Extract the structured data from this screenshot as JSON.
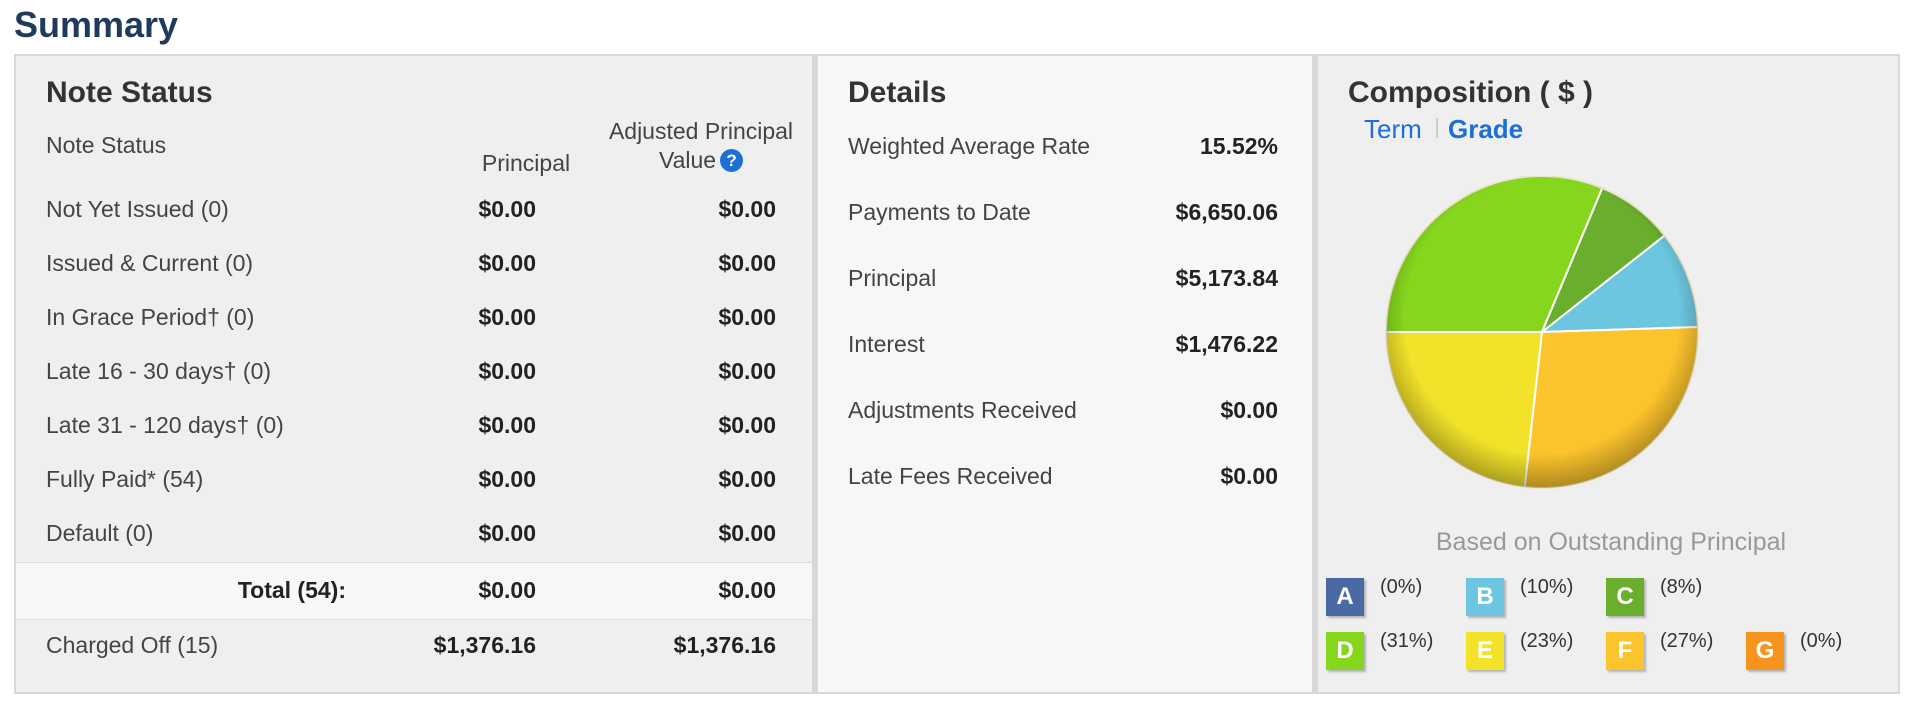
{
  "page": {
    "title": "Summary"
  },
  "note_status": {
    "title": "Note Status",
    "columns": {
      "status": "Note Status",
      "principal": "Principal",
      "adjusted_line1": "Adjusted Principal",
      "adjusted_line2": "Value"
    },
    "help_icon_glyph": "?",
    "rows": [
      {
        "label": "Not Yet Issued (0)",
        "principal": "$0.00",
        "adjusted": "$0.00"
      },
      {
        "label": "Issued & Current (0)",
        "principal": "$0.00",
        "adjusted": "$0.00"
      },
      {
        "label": "In Grace Period† (0)",
        "principal": "$0.00",
        "adjusted": "$0.00"
      },
      {
        "label": "Late 16 - 30 days† (0)",
        "principal": "$0.00",
        "adjusted": "$0.00"
      },
      {
        "label": "Late 31 - 120 days† (0)",
        "principal": "$0.00",
        "adjusted": "$0.00"
      },
      {
        "label": "Fully Paid* (54)",
        "principal": "$0.00",
        "adjusted": "$0.00"
      },
      {
        "label": "Default (0)",
        "principal": "$0.00",
        "adjusted": "$0.00"
      }
    ],
    "total": {
      "label": "Total (54):",
      "principal": "$0.00",
      "adjusted": "$0.00"
    },
    "charged_off": {
      "label": "Charged Off (15)",
      "principal": "$1,376.16",
      "adjusted": "$1,376.16"
    }
  },
  "details": {
    "title": "Details",
    "rows": [
      {
        "label": "Weighted Average Rate",
        "value": "15.52%"
      },
      {
        "label": "Payments to Date",
        "value": "$6,650.06"
      },
      {
        "label": "Principal",
        "value": "$5,173.84"
      },
      {
        "label": "Interest",
        "value": "$1,476.22"
      },
      {
        "label": "Adjustments Received",
        "value": "$0.00"
      },
      {
        "label": "Late Fees Received",
        "value": "$0.00"
      }
    ]
  },
  "composition": {
    "title": "Composition ( $ )",
    "tabs": [
      {
        "label": "Term",
        "active": false
      },
      {
        "label": "Grade",
        "active": true
      }
    ],
    "caption": "Based on Outstanding Principal",
    "legend": [
      {
        "grade": "A",
        "percent": "(0%)",
        "color": "#4a6aa5"
      },
      {
        "grade": "B",
        "percent": "(10%)",
        "color": "#6cc6e0"
      },
      {
        "grade": "C",
        "percent": "(8%)",
        "color": "#6aae2e"
      },
      {
        "grade": "D",
        "percent": "(31%)",
        "color": "#86d61e"
      },
      {
        "grade": "E",
        "percent": "(23%)",
        "color": "#f3e22a"
      },
      {
        "grade": "F",
        "percent": "(27%)",
        "color": "#fbc32c"
      },
      {
        "grade": "G",
        "percent": "(0%)",
        "color": "#f7941d"
      }
    ]
  },
  "chart_data": {
    "type": "pie",
    "categories": [
      "A",
      "B",
      "C",
      "D",
      "E",
      "F",
      "G"
    ],
    "values": [
      0,
      10,
      8,
      31,
      23,
      27,
      0
    ],
    "colors": [
      "#4a6aa5",
      "#6cc6e0",
      "#6aae2e",
      "#86d61e",
      "#f3e22a",
      "#fbc32c",
      "#f7941d"
    ],
    "title": "Composition ( $ )",
    "caption": "Based on Outstanding Principal"
  }
}
